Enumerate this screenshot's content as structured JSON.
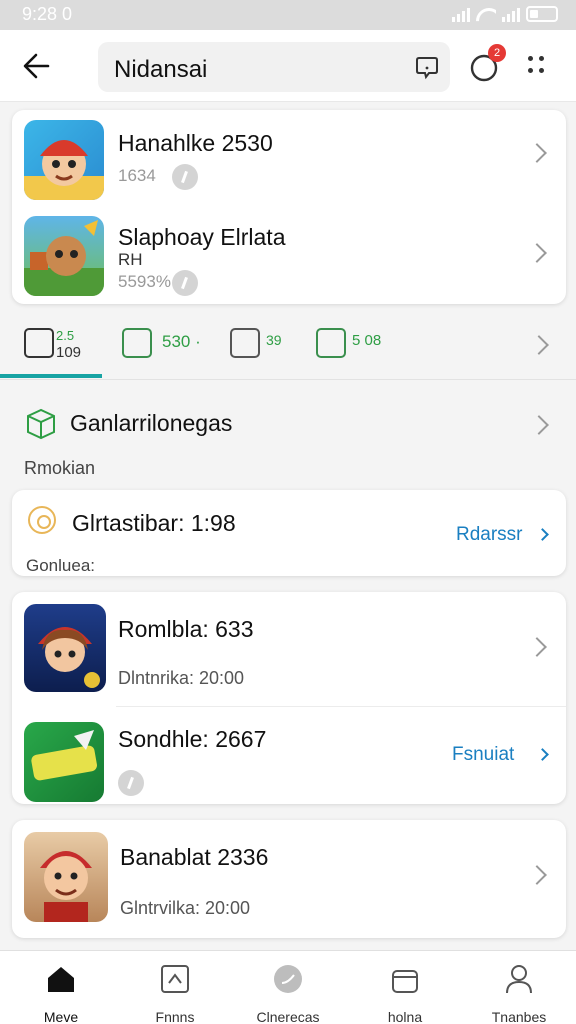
{
  "status_bar": {
    "time": "9:28 0"
  },
  "header": {
    "title": "Nidansai",
    "notification_count": "2"
  },
  "top_card": {
    "items": [
      {
        "name": "Hanahlke 2530",
        "sub": "1634"
      },
      {
        "name": "Slaphoay Elrlata",
        "dev": "RH",
        "sub": "5593%"
      }
    ]
  },
  "stats": {
    "items": [
      {
        "top": "2.5",
        "bottom": "109"
      },
      {
        "value": "530 ·"
      },
      {
        "value": "39"
      },
      {
        "value": "5 08"
      }
    ]
  },
  "section": {
    "title": "Ganlarrilonegas",
    "subtitle": "Rmokian"
  },
  "promo": {
    "title": "Glrtastibar: 1:98",
    "action": "Rdarssr",
    "sub": "Gonluea:"
  },
  "game_list": {
    "items": [
      {
        "name": "Romlbla: 633",
        "sub": "Dlntnrika: 20:00"
      },
      {
        "name": "Sondhle: 2667",
        "action": "Fsnuiat"
      }
    ]
  },
  "last_card": {
    "name": "Banablat 2336",
    "sub": "Glntrvilka: 20:00"
  },
  "bottom_nav": {
    "items": [
      {
        "label": "Meve"
      },
      {
        "label": "Fnnns"
      },
      {
        "label": "Clnerecas"
      },
      {
        "label": "holna"
      },
      {
        "label": "Tnanbes"
      }
    ]
  },
  "colors": {
    "accent_blue": "#1a7fc1",
    "accent_green": "#2e9e44",
    "tab_teal": "#17a3a3",
    "badge_red": "#e53935"
  }
}
